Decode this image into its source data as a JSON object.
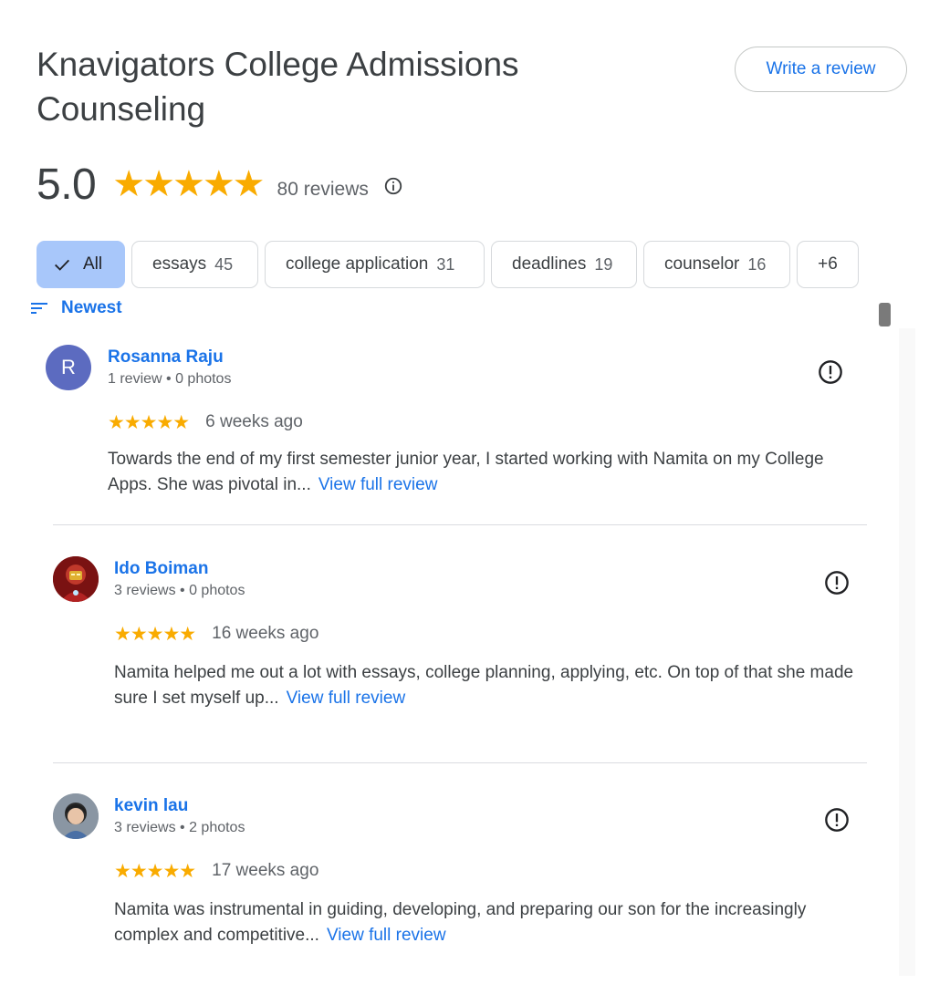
{
  "place": {
    "name": "Knavigators College Admissions Counseling"
  },
  "actions": {
    "write_review": "Write a review"
  },
  "summary": {
    "rating": "5.0",
    "stars": "★★★★★",
    "review_count": "80 reviews"
  },
  "chips": [
    {
      "label": "All",
      "count": ""
    },
    {
      "label": "essays",
      "count": "45"
    },
    {
      "label": "college application",
      "count": "31"
    },
    {
      "label": "deadlines",
      "count": "19"
    },
    {
      "label": "counselor",
      "count": "16"
    },
    {
      "label": "+6",
      "count": ""
    }
  ],
  "sort": {
    "label": "Newest"
  },
  "reviews": [
    {
      "avatar_letter": "R",
      "name": "Rosanna Raju",
      "meta": "1 review • 0 photos",
      "stars": "★★★★★",
      "time": "6 weeks ago",
      "text": "Towards the end of my first semester junior year, I started working with Namita on my College Apps. She was pivotal in...",
      "more": "View full review"
    },
    {
      "avatar_letter": "",
      "name": "Ido Boiman",
      "meta": "3 reviews • 0 photos",
      "stars": "★★★★★",
      "time": "16 weeks ago",
      "text": "Namita helped me out a lot with essays, college planning, applying, etc. On top of that she made sure I set myself up...",
      "more": "View full review"
    },
    {
      "avatar_letter": "",
      "name": "kevin lau",
      "meta": "3 reviews • 2 photos",
      "stars": "★★★★★",
      "time": "17 weeks ago",
      "text": "Namita was instrumental in guiding, developing, and preparing our son for the increasingly complex and competitive...",
      "more": "View full review"
    }
  ],
  "colors": {
    "accent": "#1a73e8",
    "star": "#f9ab00",
    "chip_active": "#a8c7fa",
    "avatar_r": "#5c6bc0"
  }
}
